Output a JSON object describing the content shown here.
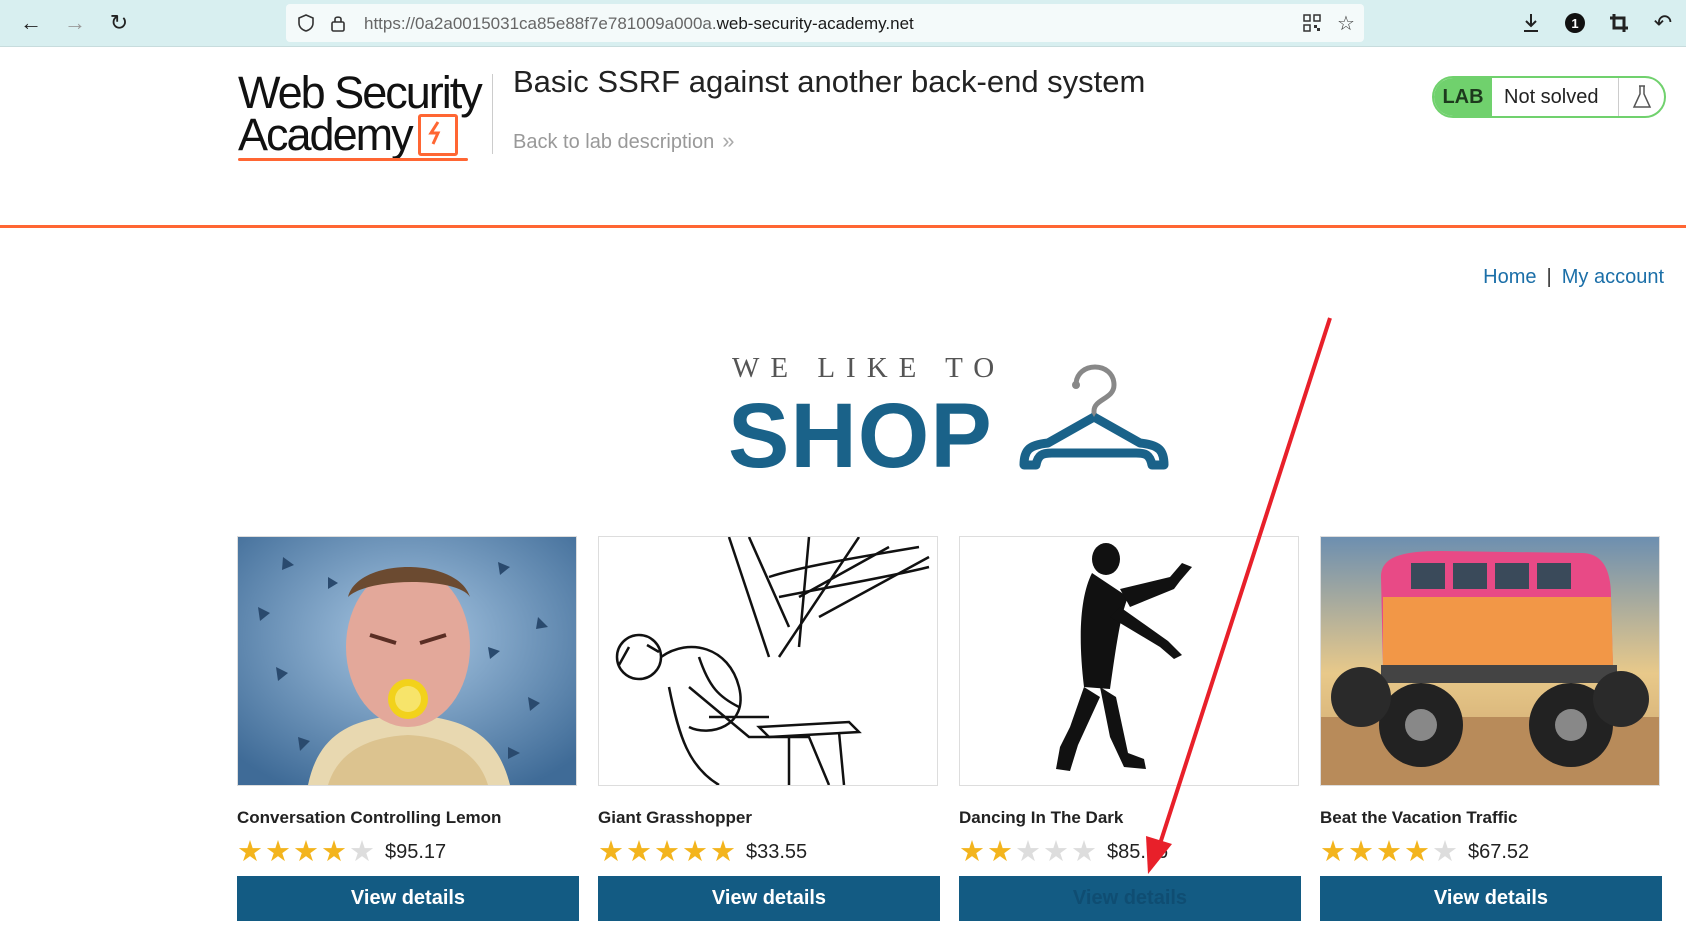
{
  "browser": {
    "url_prefix": "https://0a2a0015031ca85e88f7e781009a000a.",
    "url_domain": "web-security-academy.net"
  },
  "academy": {
    "logo_line1": "Web Security",
    "logo_line2": "Academy",
    "lab_title": "Basic SSRF against another back-end system",
    "back_link": "Back to lab description",
    "lab_badge": "LAB",
    "lab_status": "Not solved"
  },
  "nav": {
    "home": "Home",
    "separator": "|",
    "my_account": "My account"
  },
  "banner": {
    "we_like_to": "WE LIKE TO",
    "shop": "SHOP"
  },
  "products": [
    {
      "name": "Conversation Controlling Lemon",
      "rating": 4,
      "price": "$95.17",
      "button": "View details"
    },
    {
      "name": "Giant Grasshopper",
      "rating": 5,
      "price": "$33.55",
      "button": "View details"
    },
    {
      "name": "Dancing In The Dark",
      "rating": 2,
      "price": "$85.76",
      "button": "View details"
    },
    {
      "name": "Beat the Vacation Traffic",
      "rating": 4,
      "price": "$67.52",
      "button": "View details"
    }
  ],
  "colors": {
    "accent_orange": "#ff6633",
    "button_blue": "#135b83",
    "lab_green": "#70d16d",
    "star": "#f3b41d",
    "annotation_red": "#e8202a"
  }
}
